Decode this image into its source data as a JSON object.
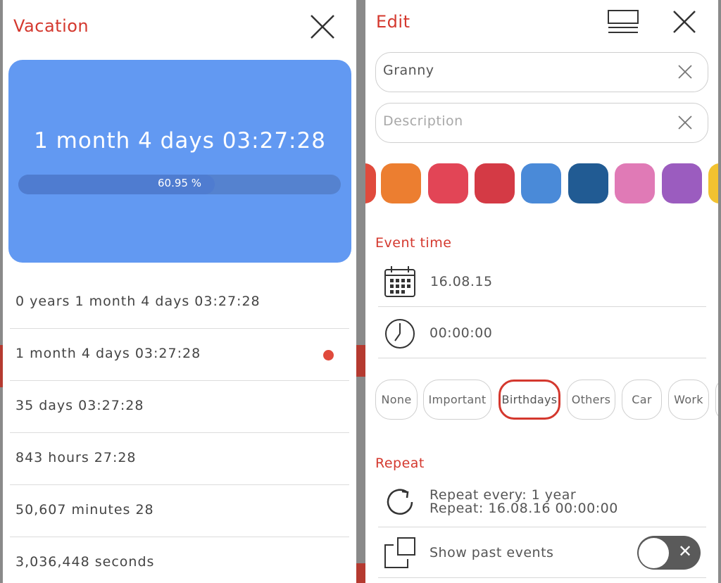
{
  "left": {
    "title": "Vacation",
    "countdown": "1 month 4 days 03:27:28",
    "progress": {
      "label": "60.95 %",
      "fraction": 0.6095
    },
    "rows": [
      {
        "text": "0 years 1 month 4 days 03:27:28",
        "selected": false
      },
      {
        "text": "1 month 4 days 03:27:28",
        "selected": true
      },
      {
        "text": "35 days 03:27:28",
        "selected": false
      },
      {
        "text": "843 hours 27:28",
        "selected": false
      },
      {
        "text": "50,607 minutes 28",
        "selected": false
      },
      {
        "text": "3,036,448 seconds",
        "selected": false
      }
    ],
    "colors": {
      "card": "#6299f2",
      "accent": "#d4382e",
      "dot": "#e04a3c"
    }
  },
  "right": {
    "title": "Edit",
    "name_field": {
      "value": "Granny",
      "placeholder": ""
    },
    "description_field": {
      "value": "",
      "placeholder": "Description"
    },
    "swatches": [
      "#e04a3c",
      "#ec7e30",
      "#e24556",
      "#d43a45",
      "#4a8ad8",
      "#215b93",
      "#e07ab6",
      "#9b5cbf",
      "#f2c230"
    ],
    "event_time_label": "Event time",
    "date": "16.08.15",
    "time": "00:00:00",
    "categories": [
      {
        "label": "None",
        "selected": false
      },
      {
        "label": "Important",
        "selected": false
      },
      {
        "label": "Birthdays",
        "selected": true
      },
      {
        "label": "Others",
        "selected": false
      },
      {
        "label": "Car",
        "selected": false
      },
      {
        "label": "Work",
        "selected": false
      }
    ],
    "repeat_label": "Repeat",
    "repeat_every": "Repeat every: 1 year",
    "repeat_next": "Repeat: 16.08.16 00:00:00",
    "show_past_label": "Show past events",
    "show_past_enabled": false,
    "icons": [
      "close-icon",
      "list-view-icon",
      "calendar-icon",
      "clock-icon",
      "repeat-icon",
      "copy-icon"
    ]
  }
}
